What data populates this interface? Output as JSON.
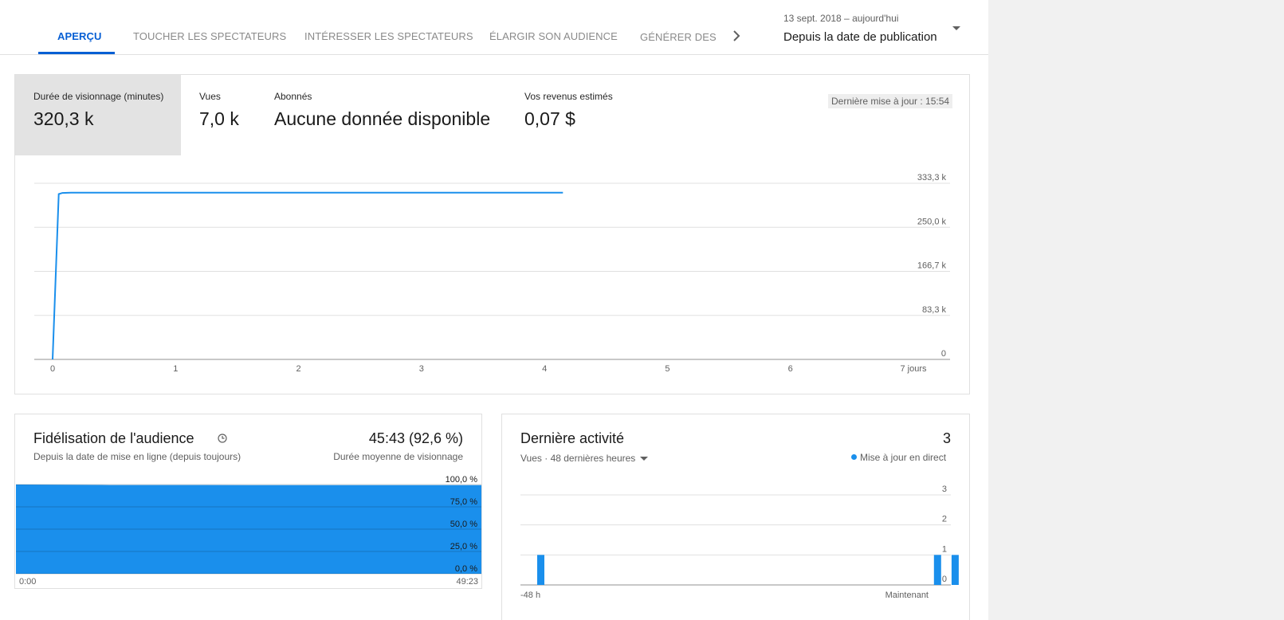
{
  "tabs": [
    {
      "label": "APERÇU",
      "active": true
    },
    {
      "label": "TOUCHER LES SPECTATEURS",
      "active": false
    },
    {
      "label": "INTÉRESSER LES SPECTATEURS",
      "active": false
    },
    {
      "label": "ÉLARGIR SON AUDIENCE",
      "active": false
    },
    {
      "label": "GÉNÉRER DES RI",
      "active": false
    }
  ],
  "date_range": {
    "period": "13 sept. 2018 – aujourd'hui",
    "selection": "Depuis la date de publication"
  },
  "metrics": [
    {
      "label": "Durée de visionnage (minutes)",
      "value": "320,3 k",
      "selected": true
    },
    {
      "label": "Vues",
      "value": "7,0 k",
      "selected": false
    },
    {
      "label": "Abonnés",
      "value": "Aucune donnée disponible",
      "selected": false
    },
    {
      "label": "Vos revenus estimés",
      "value": "0,07 $",
      "selected": false
    }
  ],
  "last_updated": "Dernière mise à jour : 15:54",
  "colors": {
    "accent": "#065fd4",
    "series": "#1a8fec",
    "grid": "#e0e0e0"
  },
  "icons": {
    "tab_next": "chevron-right-icon",
    "date_dropdown": "caret-down-icon",
    "retention_info": "clock-icon",
    "activity_dropdown": "caret-down-icon",
    "live": "live-dot-icon"
  },
  "retention": {
    "title": "Fidélisation de l'audience",
    "subtitle": "Depuis la date de mise en ligne (depuis toujours)",
    "avg_value": "45:43 (92,6 %)",
    "avg_label": "Durée moyenne de visionnage"
  },
  "activity": {
    "title": "Dernière activité",
    "count": "3",
    "selector": "Vues · 48 dernières heures",
    "live_label": "Mise à jour en direct"
  },
  "chart_data": [
    {
      "type": "line",
      "x_ticks": [
        "0",
        "1",
        "2",
        "3",
        "4",
        "5",
        "6",
        "7 jours"
      ],
      "y_ticks": [
        "0",
        "83,3 k",
        "166,7 k",
        "250,0 k",
        "333,3 k"
      ],
      "ylim": [
        0,
        333300
      ],
      "xlim": [
        0,
        7
      ],
      "y_axis_position": "right",
      "grid": true,
      "series": [
        {
          "x": [
            0,
            0.05,
            0.08,
            0.15,
            4.15
          ],
          "y": [
            0,
            313000,
            315000,
            315500,
            315500
          ]
        }
      ]
    },
    {
      "type": "area",
      "x_ticks": [
        "0:00",
        "49:23"
      ],
      "y_ticks": [
        "0,0 %",
        "25,0 %",
        "50,0 %",
        "75,0 %",
        "100,0 %"
      ],
      "ylim": [
        0,
        100
      ],
      "xlim": [
        0,
        1
      ],
      "y_axis_position": "right",
      "grid": true,
      "series": [
        {
          "x": [
            0,
            0.2,
            0.5,
            1
          ],
          "y": [
            100,
            99.5,
            99.4,
            99.3
          ]
        }
      ]
    },
    {
      "type": "bar",
      "x_ticks": [
        "-48 h",
        "Maintenant"
      ],
      "y_ticks": [
        "0",
        "1",
        "2",
        "3"
      ],
      "ylim": [
        0,
        3
      ],
      "y_axis_position": "right",
      "grid": true,
      "bins": 48,
      "values": [
        1,
        0,
        0,
        0,
        0,
        0,
        0,
        0,
        0,
        0,
        0,
        0,
        0,
        0,
        0,
        0,
        0,
        0,
        0,
        0,
        0,
        0,
        0,
        0,
        0,
        0,
        0,
        0,
        0,
        0,
        0,
        0,
        0,
        0,
        0,
        0,
        0,
        0,
        0,
        0,
        0,
        0,
        0,
        0,
        0,
        1,
        0,
        1
      ]
    }
  ]
}
